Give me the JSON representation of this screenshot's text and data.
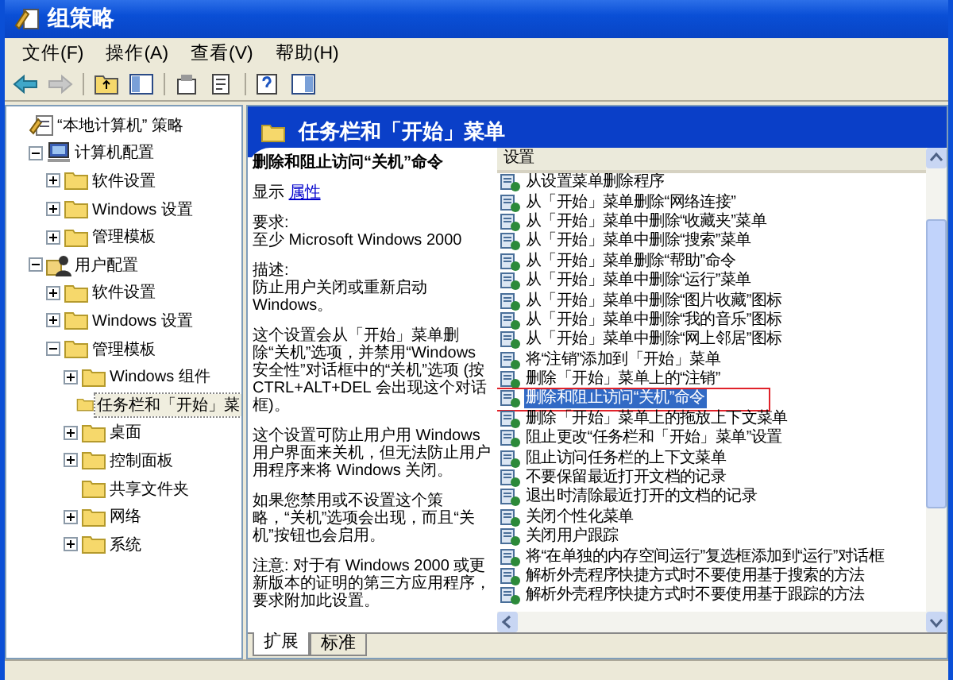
{
  "window": {
    "title": "组策略"
  },
  "menu": [
    {
      "label": "文件(F)"
    },
    {
      "label": "操作(A)"
    },
    {
      "label": "查看(V)"
    },
    {
      "label": "帮助(H)"
    }
  ],
  "tree": [
    {
      "label": "“本地计算机” 策略",
      "kind": "policy",
      "selected": false,
      "children": [
        {
          "label": "计算机配置",
          "kind": "computer",
          "expanded": true,
          "selected": false,
          "children": [
            {
              "label": "软件设置",
              "kind": "folder",
              "expanded": false,
              "selected": false
            },
            {
              "label": "Windows 设置",
              "kind": "folder",
              "expanded": false,
              "selected": false
            },
            {
              "label": "管理模板",
              "kind": "folder",
              "expanded": false,
              "selected": false
            }
          ]
        },
        {
          "label": "用户配置",
          "kind": "user",
          "expanded": true,
          "selected": false,
          "children": [
            {
              "label": "软件设置",
              "kind": "folder",
              "expanded": false,
              "selected": false
            },
            {
              "label": "Windows 设置",
              "kind": "folder",
              "expanded": false,
              "selected": false
            },
            {
              "label": "管理模板",
              "kind": "folder",
              "expanded": true,
              "selected": false,
              "children": [
                {
                  "label": "Windows 组件",
                  "kind": "folder",
                  "expanded": false,
                  "selected": false
                },
                {
                  "label": "任务栏和「开始」菜",
                  "kind": "folder",
                  "selected": true
                },
                {
                  "label": "桌面",
                  "kind": "folder",
                  "expanded": false,
                  "selected": false
                },
                {
                  "label": "控制面板",
                  "kind": "folder",
                  "expanded": false,
                  "selected": false
                },
                {
                  "label": "共享文件夹",
                  "kind": "folder",
                  "selected": false
                },
                {
                  "label": "网络",
                  "kind": "folder",
                  "expanded": false,
                  "selected": false
                },
                {
                  "label": "系统",
                  "kind": "folder",
                  "expanded": false,
                  "selected": false
                }
              ]
            }
          ]
        }
      ]
    }
  ],
  "header": {
    "title": "任务栏和「开始」菜单"
  },
  "description": {
    "title": "删除和阻止访问“关机”命令",
    "show_label": "显示",
    "show_link": "属性",
    "paragraphs": [
      "要求:\n至少 Microsoft Windows 2000",
      "描述:\n防止用户关闭或重新启动 Windows。",
      "这个设置会从「开始」菜单删除“关机”选项，并禁用“Windows 安全性”对话框中的“关机”选项 (按 CTRL+ALT+DEL 会出现这个对话框)。",
      "这个设置可防止用户用 Windows 用户界面来关机，但无法防止用户用程序来将 Windows 关闭。",
      "如果您禁用或不设置这个策略，“关机”选项会出现，而且“关机”按钮也会启用。",
      "注意: 对于有 Windows 2000 或更新版本的证明的第三方应用程序，要求附加此设置。"
    ]
  },
  "list": {
    "column": "设置",
    "rows": [
      {
        "label": "从设置菜单删除程序",
        "selected": false,
        "marked": false
      },
      {
        "label": "从「开始」菜单删除“网络连接”",
        "selected": false,
        "marked": false
      },
      {
        "label": "从「开始」菜单中删除“收藏夹”菜单",
        "selected": false,
        "marked": false
      },
      {
        "label": "从「开始」菜单中删除“搜索”菜单",
        "selected": false,
        "marked": false
      },
      {
        "label": "从「开始」菜单删除“帮助”命令",
        "selected": false,
        "marked": false
      },
      {
        "label": "从「开始」菜单中删除“运行”菜单",
        "selected": false,
        "marked": false
      },
      {
        "label": "从「开始」菜单中删除“图片收藏”图标",
        "selected": false,
        "marked": false
      },
      {
        "label": "从「开始」菜单中删除“我的音乐”图标",
        "selected": false,
        "marked": false
      },
      {
        "label": "从「开始」菜单中删除“网上邻居”图标",
        "selected": false,
        "marked": false
      },
      {
        "label": "将“注销”添加到「开始」菜单",
        "selected": false,
        "marked": false
      },
      {
        "label": "删除「开始」菜单上的“注销”",
        "selected": false,
        "marked": false
      },
      {
        "label": "删除和阻止访问“关机”命令",
        "selected": true,
        "marked": true
      },
      {
        "label": "删除「开始」菜单上的拖放上下文菜单",
        "selected": false,
        "marked": false
      },
      {
        "label": "阻止更改“任务栏和「开始」菜单”设置",
        "selected": false,
        "marked": false
      },
      {
        "label": "阻止访问任务栏的上下文菜单",
        "selected": false,
        "marked": false
      },
      {
        "label": "不要保留最近打开文档的记录",
        "selected": false,
        "marked": false
      },
      {
        "label": "退出时清除最近打开的文档的记录",
        "selected": false,
        "marked": false
      },
      {
        "label": "关闭个性化菜单",
        "selected": false,
        "marked": false
      },
      {
        "label": "关闭用户跟踪",
        "selected": false,
        "marked": false
      },
      {
        "label": "将“在单独的内存空间运行”复选框添加到“运行”对话框",
        "selected": false,
        "marked": false
      },
      {
        "label": "解析外壳程序快捷方式时不要使用基于搜索的方法",
        "selected": false,
        "marked": false
      },
      {
        "label": "解析外壳程序快捷方式时不要使用基于跟踪的方法",
        "selected": false,
        "marked": false
      }
    ]
  },
  "tabs": [
    {
      "label": "扩展",
      "selected": true
    },
    {
      "label": "标准",
      "selected": false
    }
  ]
}
